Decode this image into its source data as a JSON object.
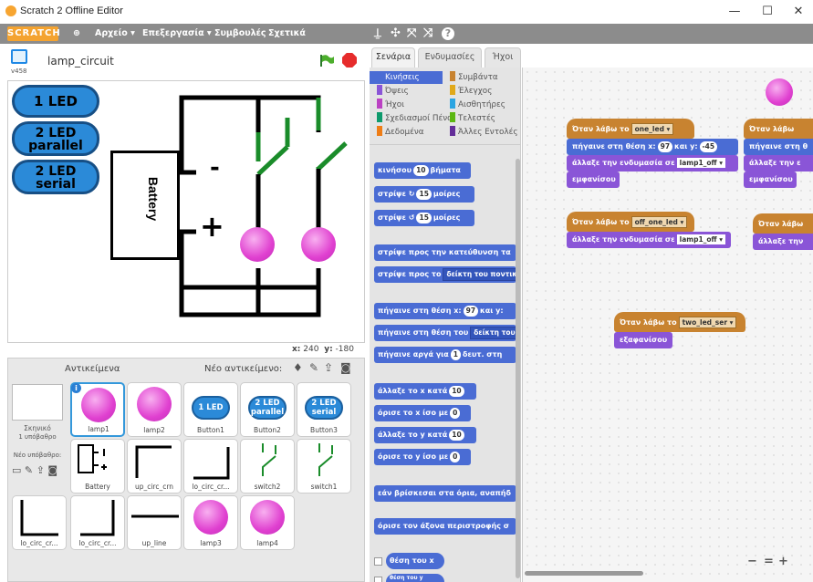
{
  "window": {
    "title": "Scratch 2 Offline Editor",
    "min": "—",
    "max": "☐",
    "close": "✕"
  },
  "menubar": {
    "logo": "SCRATCH",
    "items": [
      "Αρχείο ▾",
      "Επεξεργασία ▾",
      "Συμβουλές",
      "Σχετικά"
    ]
  },
  "stage": {
    "project_name": "lamp_circuit",
    "version": "v458",
    "battery_label": "Battery",
    "minus": "-",
    "plus": "+",
    "x_label": "x:",
    "x": "240",
    "y_label": "y:",
    "y": "-180"
  },
  "stage_buttons": [
    {
      "label": "1 LED"
    },
    {
      "label": "2 LED parallel"
    },
    {
      "label": "2 LED serial"
    }
  ],
  "sprites": {
    "header": "Αντικείμενα",
    "new_label": "Νέο αντικείμενο:",
    "scene": "Σκηνικό",
    "scene_sub": "1 υπόβαθρο",
    "new_backdrop": "Νέο υπόβαθρο:",
    "items": [
      "lamp1",
      "lamp2",
      "Button1",
      "Button2",
      "Button3",
      "Battery",
      "up_circ_crn",
      "lo_circ_cr...",
      "switch2",
      "switch1",
      "lo_circ_cr...",
      "lo_circ_cr...",
      "up_line",
      "lamp3",
      "lamp4"
    ],
    "thumb_btns": [
      "1 LED",
      "2 LED parallel",
      "2 LED serial"
    ]
  },
  "tabs": [
    "Σενάρια",
    "Ενδυμασίες",
    "Ήχοι"
  ],
  "categories": [
    [
      "Κινήσεις",
      "Συμβάντα"
    ],
    [
      "Όψεις",
      "Έλεγχος"
    ],
    [
      "Ήχοι",
      "Αισθητήρες"
    ],
    [
      "Σχεδιασμοί Πένα",
      "Τελεστές"
    ],
    [
      "Δεδομένα",
      "Άλλες Εντολές"
    ]
  ],
  "cat_colors": [
    "#4a6cd4",
    "#c88330",
    "#8a55d7",
    "#e1a91a",
    "#bb42c3",
    "#2ca5e2",
    "#0e9a6c",
    "#5cb712",
    "#ee7d16",
    "#632d99"
  ],
  "palette": {
    "b1": "κινήσου",
    "b1n": "10",
    "b1e": "βήματα",
    "b2": "στρίψε ↻",
    "b2n": "15",
    "b2e": "μοίρες",
    "b3": "στρίψε ↺",
    "b3n": "15",
    "b3e": "μοίρες",
    "b4": "στρίψε προς την κατεύθυνση τα",
    "b5": "στρίψε προς το",
    "b5d": "δείκτη του ποντικι",
    "b6": "πήγαινε στη θέση x:",
    "b6x": "97",
    "b6y": "και y:",
    "b7": "πήγαινε στη θέση του",
    "b7d": "δείκτη του",
    "b8": "πήγαινε αργά για",
    "b8n": "1",
    "b8e": "δευτ. στη",
    "b9": "άλλαξε το x κατά",
    "b9n": "10",
    "b10": "όρισε το x ίσο με",
    "b10n": "0",
    "b11": "άλλαξε το y κατά",
    "b11n": "10",
    "b12": "όρισε το y ίσο με",
    "b12n": "0",
    "b13": "εάν βρίσκεσαι στα όρια, αναπήδ",
    "b14": "όρισε τον άξονα περιστροφής σ",
    "r1": "θέση του x",
    "r2": "θέση του y"
  },
  "scripts": {
    "h1": "Όταν λάβω το",
    "h1d": "one_led ▾",
    "s1": "πήγαινε στη θέση x:",
    "s1x": "97",
    "s1y": "και y:",
    "s1yv": "-45",
    "s2": "άλλαξε την ενδυμασία σε",
    "s2d": "lamp1_off ▾",
    "s3": "εμφανίσου",
    "h2": "Όταν λάβω το",
    "h2d": "off_one_led ▾",
    "s4": "άλλαξε την ενδυμασία σε",
    "s4d": "lamp1_off ▾",
    "h3": "Όταν λάβω το",
    "h3d": "two_led_ser ▾",
    "s5": "εξαφανίσου",
    "h4": "Όταν λάβω",
    "s6": "πήγαινε στη θ",
    "s7": "άλλαξε την ε",
    "s8": "εμφανίσου",
    "h5": "Όταν λάβω",
    "s9": "άλλαξε την",
    "zoom_minus": "−",
    "zoom_eq": "=",
    "zoom_plus": "+"
  }
}
